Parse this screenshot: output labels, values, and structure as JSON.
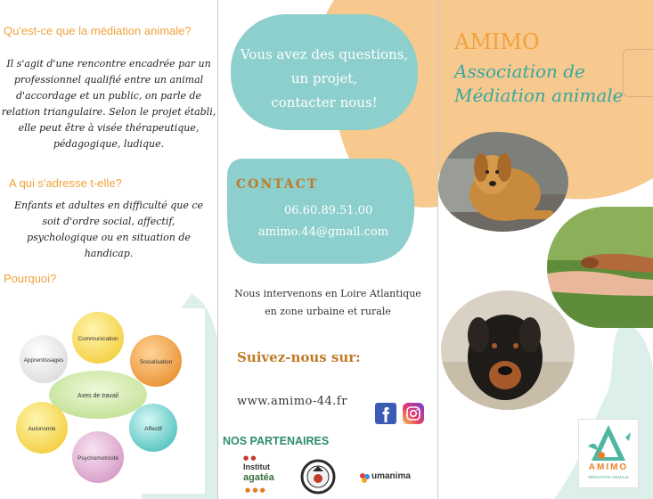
{
  "panel_left": {
    "heading_what": "Qu'est-ce que la médiation animale?",
    "para_what": [
      "Il s'agit d'une rencontre encadrée par un",
      "professionnel qualifié entre un animal",
      "d'accordage et un public, on parle de",
      "relation triangulaire. Selon le projet établi,",
      "elle peut être à visée thérapeutique,",
      "pédagogique, ludique."
    ],
    "heading_who": "A qui s'adresse t-elle?",
    "para_who": [
      "Enfants et adultes en difficulté que  ce",
      "soit d'ordre social, affectif,",
      "psychologique ou en situation de",
      "handicap."
    ],
    "heading_why": "Pourquoi?",
    "diagram": {
      "center": "Axes de travail",
      "nodes": [
        "Communication",
        "Socialisation",
        "Affectif",
        "Psychomotricité",
        "Autonomie",
        "Apprentissages"
      ]
    }
  },
  "panel_middle": {
    "questions_lines": [
      "Vous avez des questions,",
      "un projet,",
      "contacter nous!"
    ],
    "contact_title": "CONTACT",
    "phone": "06.60.89.51.00",
    "email": "amimo.44@gmail.com",
    "zone_lines": [
      "Nous intervenons en Loire Atlantique",
      "en zone urbaine et rurale"
    ],
    "follow": "Suivez-nous sur:",
    "website": "www.amimo-44.fr",
    "partners_title": "NOS PARTENAIRES",
    "partners": [
      "Institut",
      "agatéa",
      "umanima"
    ]
  },
  "panel_right": {
    "title": "AMIMO",
    "subtitle_lines": [
      "Association de",
      "Médiation animale"
    ],
    "logo_text": "AMIMO",
    "logo_sub": "MÉDIATION ANIMALE"
  },
  "colors": {
    "orange": "#f0a23a",
    "peach": "#f7c98f",
    "teal": "#8ccfcc",
    "light_teal": "#dcefe9",
    "green_heading": "#2e8b6f"
  },
  "icons": [
    "facebook-icon",
    "instagram-icon"
  ]
}
